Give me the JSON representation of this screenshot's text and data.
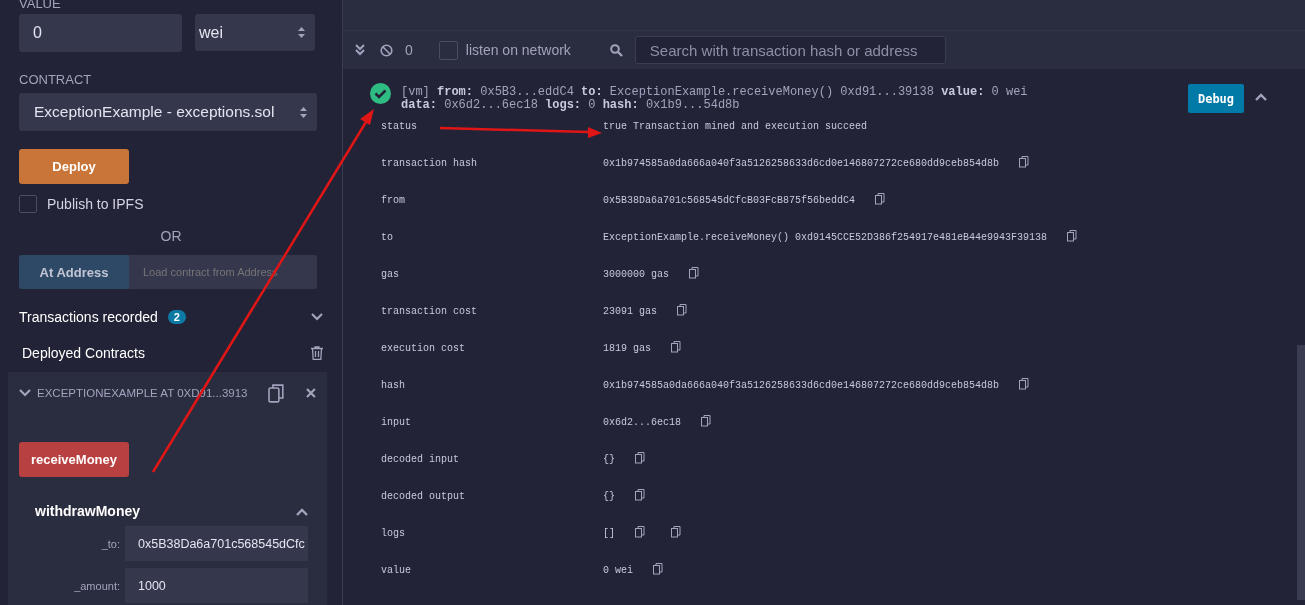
{
  "sidebar": {
    "value_label": "VALUE",
    "value": "0",
    "unit": "wei",
    "contract_label": "CONTRACT",
    "contract": "ExceptionExample - exceptions.sol",
    "deploy_button": "Deploy",
    "publish_ipfs": {
      "label": "Publish to IPFS",
      "checked": false
    },
    "or_label": "OR",
    "at_address_button": "At Address",
    "address_placeholder": "Load contract from Address",
    "transactions_recorded": {
      "label": "Transactions recorded",
      "count": "2",
      "expanded": false
    },
    "deployed_contracts": {
      "label": "Deployed Contracts"
    },
    "instance": {
      "title": "EXCEPTIONEXAMPLE AT 0XD91...3913",
      "expanded": true,
      "functions": [
        {
          "kind": "button",
          "label": "receiveMoney"
        },
        {
          "kind": "form",
          "label": "withdrawMoney",
          "expanded": true,
          "params": [
            {
              "name": "_to:",
              "value": "0x5B38Da6a701c568545dCfc"
            },
            {
              "name": "_amount:",
              "value": "1000"
            }
          ]
        }
      ]
    }
  },
  "terminal": {
    "count": "0",
    "listen_on_network": {
      "label": "listen on network",
      "checked": false
    },
    "search_placeholder": "Search with transaction hash or address",
    "log": {
      "expanded": true,
      "debug_button": "Debug",
      "summary": [
        "[vm]  **from:** 0x5B3...eddC4 **to:** ExceptionExample.receiveMoney() 0xd91...39138 **value:** 0 wei",
        "**data:** 0x6d2...6ec18 **logs:** 0 **hash:** 0x1b9...54d8b"
      ],
      "rows": [
        {
          "label": "status",
          "value": "true Transaction mined and execution succeed",
          "kind": "plain"
        },
        {
          "label": "transaction hash",
          "value": "0x1b974585a0da666a040f3a5126258633d6cd0e146807272ce680dd9ceb854d8b",
          "kind": "copy"
        },
        {
          "label": "from",
          "value": "0x5B38Da6a701c568545dCfcB03FcB875f56beddC4",
          "kind": "copy"
        },
        {
          "label": "to",
          "value": "ExceptionExample.receiveMoney() 0xd9145CCE52D386f254917e481eB44e9943F39138",
          "kind": "copy"
        },
        {
          "label": "gas",
          "value": "3000000 gas",
          "kind": "copy"
        },
        {
          "label": "transaction cost",
          "value": "23091 gas",
          "kind": "copy"
        },
        {
          "label": "execution cost",
          "value": "1819 gas",
          "kind": "copy"
        },
        {
          "label": "hash",
          "value": "0x1b974585a0da666a040f3a5126258633d6cd0e146807272ce680dd9ceb854d8b",
          "kind": "copy"
        },
        {
          "label": "input",
          "value": "0x6d2...6ec18",
          "kind": "copy"
        },
        {
          "label": "decoded input",
          "value": "{}",
          "kind": "copy"
        },
        {
          "label": "decoded output",
          "value": "{}",
          "kind": "copy"
        },
        {
          "label": "logs",
          "value": "[]",
          "kind": "copy-twice"
        },
        {
          "label": "value",
          "value": "0 wei",
          "kind": "copy"
        }
      ]
    }
  }
}
